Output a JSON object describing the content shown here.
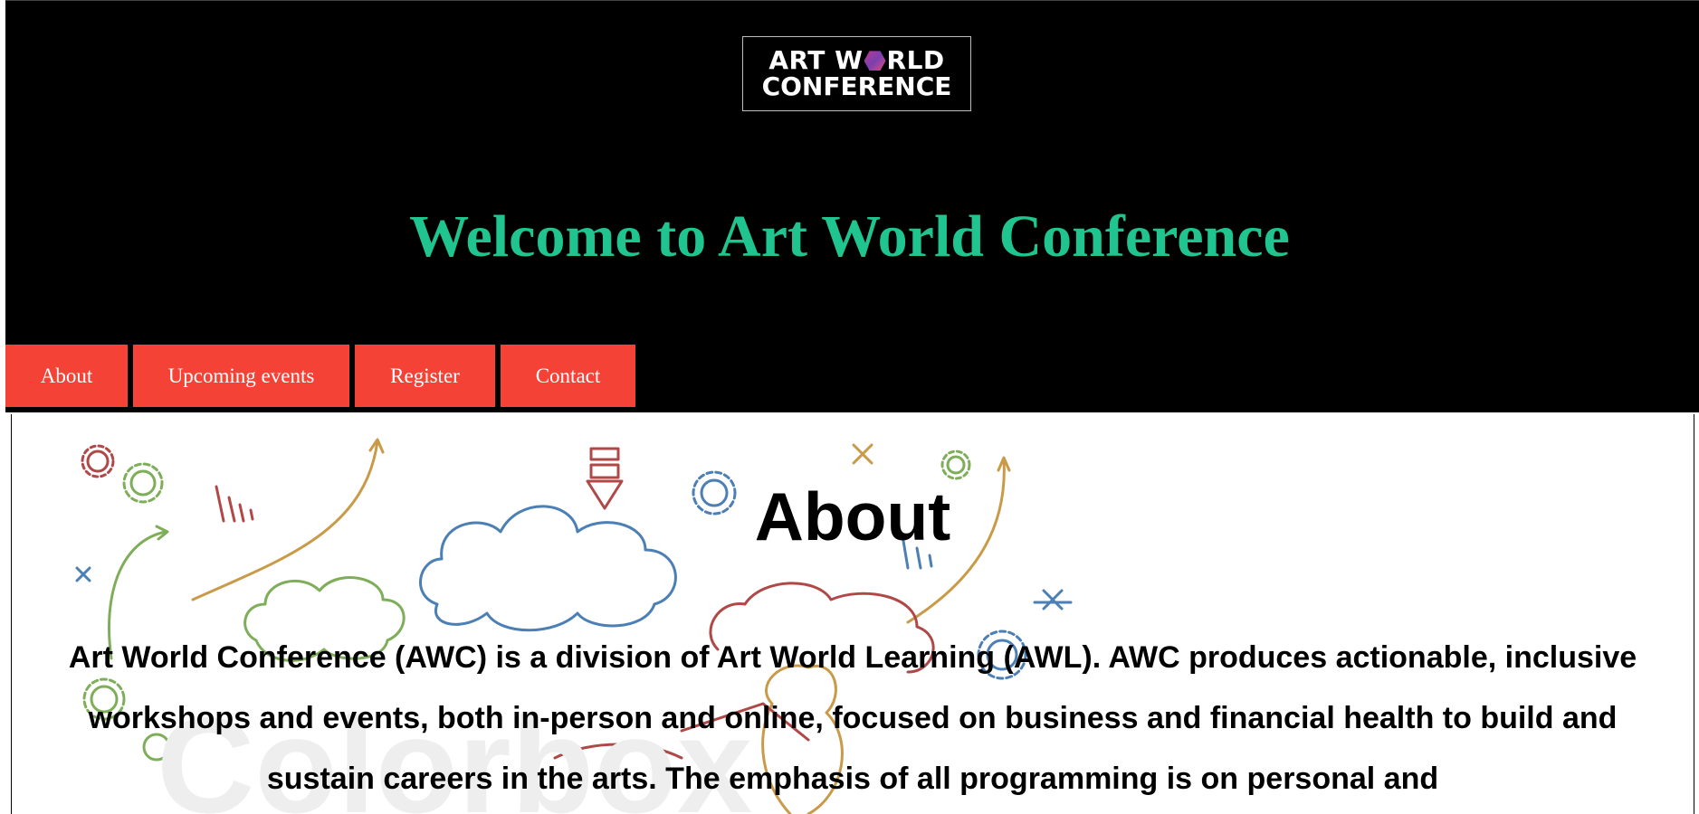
{
  "logo": {
    "line1_a": "ART W",
    "line1_b": "RLD",
    "line2": "CONFERENCE"
  },
  "header": {
    "welcome": "Welcome to Art World Conference"
  },
  "nav": {
    "items": [
      {
        "label": "About"
      },
      {
        "label": "Upcoming events"
      },
      {
        "label": "Register"
      },
      {
        "label": "Contact"
      }
    ]
  },
  "about": {
    "title": "About",
    "body": "Art World Conference (AWC) is a division of Art World Learning (AWL). AWC produces actionable, inclusive workshops and events, both in-person and online, focused on business and financial health to build and sustain careers in the arts. The emphasis of all programming is on personal and"
  },
  "colors": {
    "header_bg": "#000000",
    "welcome": "#1fc48f",
    "nav_bg": "#f44336",
    "nav_text": "#ffffff"
  },
  "icons": [
    "logo-hexagon-icon",
    "doodle-background-image"
  ]
}
